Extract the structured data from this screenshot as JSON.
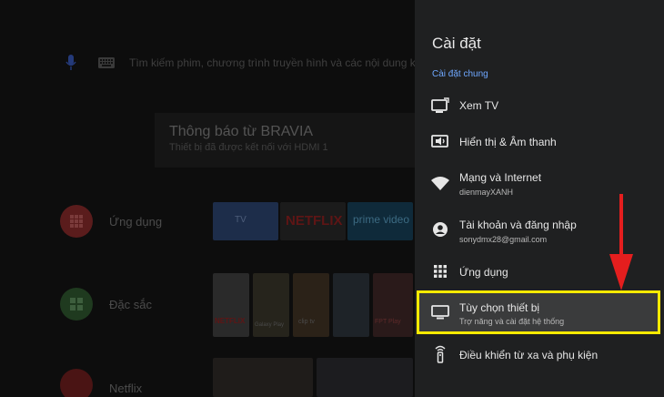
{
  "background": {
    "search_placeholder": "Tìm kiếm phim, chương trình truyền hình và các nội dung kh",
    "notice": {
      "title": "Thông báo từ BRAVIA",
      "message": "Thiết bị đã được kết nối với HDMI 1"
    },
    "rows": [
      {
        "label": "Ứng dụng"
      },
      {
        "label": "Đặc sắc"
      },
      {
        "label": "Netflix"
      }
    ],
    "tiles": {
      "tv": "TV",
      "netflix": "NETFLIX",
      "prime": "prime video",
      "netflix_small": "NETFLIX",
      "galaxy": "Galaxy Play",
      "fpt": "FPT Play",
      "clip": "clip tv"
    }
  },
  "panel": {
    "title": "Cài đặt",
    "section": "Cài đặt chung",
    "items": [
      {
        "label": "Xem TV",
        "sub": "",
        "icon": "tv-input-icon"
      },
      {
        "label": "Hiển thị & Âm thanh",
        "sub": "",
        "icon": "display-sound-icon"
      },
      {
        "label": "Mạng và Internet",
        "sub": "dienmayXANH",
        "icon": "wifi-icon"
      },
      {
        "label": "Tài khoản và đăng nhập",
        "sub": "sonydmx28@gmail.com",
        "icon": "account-icon"
      },
      {
        "label": "Ứng dụng",
        "sub": "",
        "icon": "apps-grid-icon"
      },
      {
        "label": "Tùy chọn thiết bị",
        "sub": "Trợ năng và cài đặt hệ thống",
        "icon": "monitor-icon"
      },
      {
        "label": "Điều khiển từ xa và phụ kiện",
        "sub": "",
        "icon": "remote-icon"
      }
    ],
    "selected_index": 5
  },
  "colors": {
    "highlight_border": "#ffea00",
    "arrow": "#e41e1e",
    "section_blue": "#6fa8ff"
  }
}
